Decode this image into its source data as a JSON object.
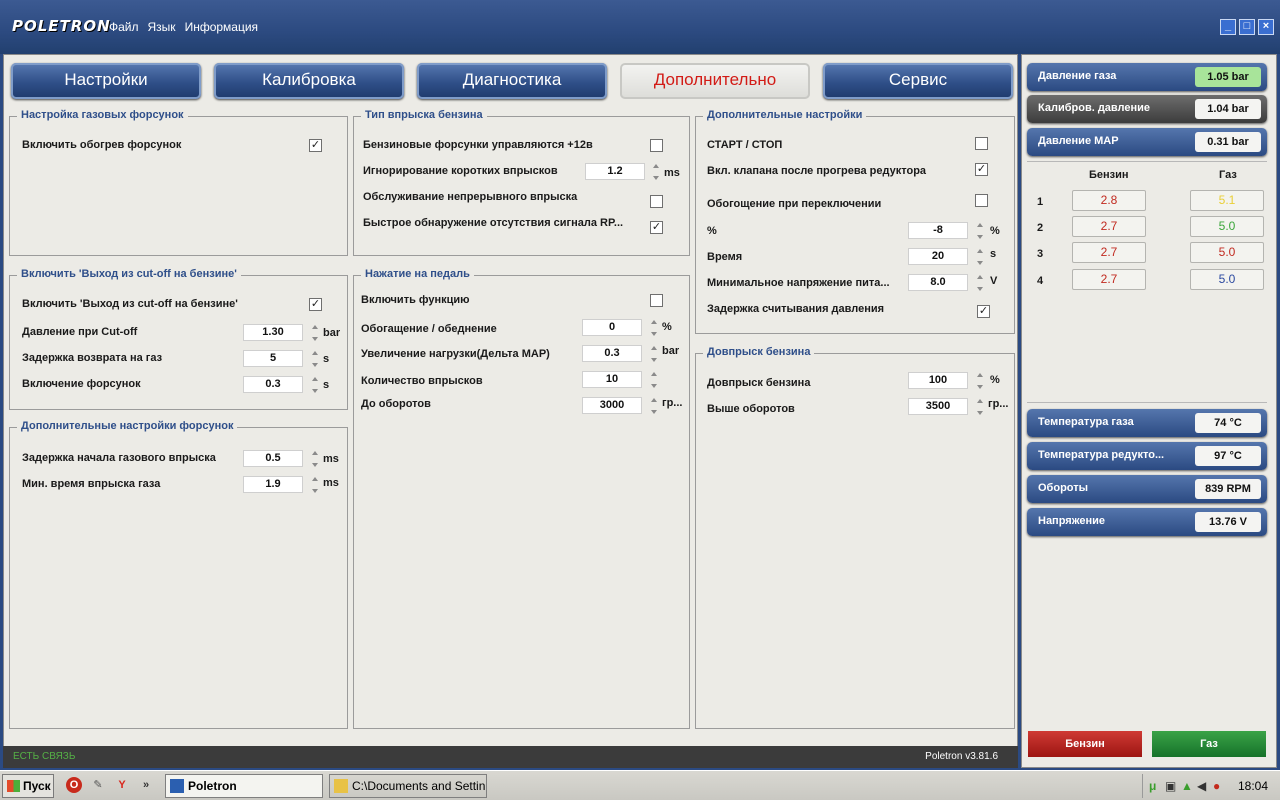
{
  "app": {
    "logo": "POLETRON"
  },
  "menu": [
    "Файл",
    "Язык",
    "Информация"
  ],
  "tabs": [
    "Настройки",
    "Калибровка",
    "Диагностика",
    "Дополнительно",
    "Сервис"
  ],
  "groups": {
    "g1": {
      "title": "Настройка газовых форсунок",
      "rows": [
        "Включить обогрев форсунок"
      ]
    },
    "g2": {
      "title": "Включить 'Выход из cut-off на бензине'",
      "check_label": "Включить 'Выход из cut-off на бензине'",
      "rows": [
        {
          "label": "Давление при Cut-off",
          "value": "1.30",
          "unit": "bar"
        },
        {
          "label": "Задержка возврата на газ",
          "value": "5",
          "unit": "s"
        },
        {
          "label": "Включение форсунок",
          "value": "0.3",
          "unit": "s"
        }
      ]
    },
    "g3": {
      "title": "Дополнительные настройки форсунок",
      "rows": [
        {
          "label": "Задержка начала газового впрыска",
          "value": "0.5",
          "unit": "ms"
        },
        {
          "label": "Мин. время впрыска газа",
          "value": "1.9",
          "unit": "ms"
        }
      ]
    },
    "g4": {
      "title": "Тип впрыска бензина",
      "rows": [
        "Бензиновые форсунки управляются +12в",
        "Игнорирование коротких впрысков",
        "Обслуживание непрерывного впрыска",
        "Быстрое обнаружение отсутствия сигнала RP..."
      ],
      "short_value": "1.2",
      "short_unit": "ms"
    },
    "g5": {
      "title": "Нажатие на педаль",
      "check_label": "Включить функцию",
      "rows": [
        {
          "label": "Обогащение / обеднение",
          "value": "0",
          "unit": "%"
        },
        {
          "label": "Увеличение нагрузки(Дельта МАР)",
          "value": "0.3",
          "unit": "bar"
        },
        {
          "label": "Количество впрысков",
          "value": "10",
          "unit": ""
        },
        {
          "label": "До оборотов",
          "value": "3000",
          "unit": "гр..."
        }
      ]
    },
    "g6": {
      "title": "Дополнительные настройки",
      "checks": [
        "СТАРТ / СТОП",
        "Вкл. клапана после прогрева редуктора",
        "Обогощение при переключении"
      ],
      "rows": [
        {
          "label": "%",
          "value": "-8",
          "unit": "%"
        },
        {
          "label": "Время",
          "value": "20",
          "unit": "s"
        },
        {
          "label": "Минимальное напряжение пита...",
          "value": "8.0",
          "unit": "V"
        }
      ],
      "last_check": "Задержка считывания давления"
    },
    "g7": {
      "title": "Довпрыск бензина",
      "rows": [
        {
          "label": "Довпрыск бензина",
          "value": "100",
          "unit": "%"
        },
        {
          "label": "Выше оборотов",
          "value": "3500",
          "unit": "гр..."
        }
      ]
    }
  },
  "status": {
    "left": "ЕСТЬ СВЯЗЬ",
    "right": "Poletron v3.81.6"
  },
  "side": {
    "pills": [
      {
        "label": "Давление газа",
        "value": "1.05 bar"
      },
      {
        "label": "Калибров. давление",
        "value": "1.04 bar"
      },
      {
        "label": "Давление MAP",
        "value": "0.31 bar"
      }
    ],
    "inj_headers": [
      "Бензин",
      "Газ"
    ],
    "injectors": [
      {
        "n": "1",
        "benz": "2.8",
        "gas": "5.1",
        "gas_color": "#e9cf35"
      },
      {
        "n": "2",
        "benz": "2.7",
        "gas": "5.0",
        "gas_color": "#3aa63a"
      },
      {
        "n": "3",
        "benz": "2.7",
        "gas": "5.0",
        "gas_color": "#c12a20"
      },
      {
        "n": "4",
        "benz": "2.7",
        "gas": "5.0",
        "gas_color": "#2b49a0"
      }
    ],
    "sensors": [
      {
        "label": "Температура газа",
        "value": "74 °C"
      },
      {
        "label": "Температура редукто...",
        "value": "97 °C"
      },
      {
        "label": "Обороты",
        "value": "839 RPM"
      },
      {
        "label": "Напряжение",
        "value": "13.76 V"
      }
    ],
    "btn_benz": "Бензин",
    "btn_gas": "Газ"
  },
  "colors": {
    "benz_value": "#c12a20",
    "accent_green": "#a8e49a",
    "tab_active_text": "#d21b16"
  },
  "taskbar": {
    "start": "Пуск",
    "tasks": [
      "Poletron",
      "C:\\Documents and Settin..."
    ],
    "clock": "18:04"
  }
}
